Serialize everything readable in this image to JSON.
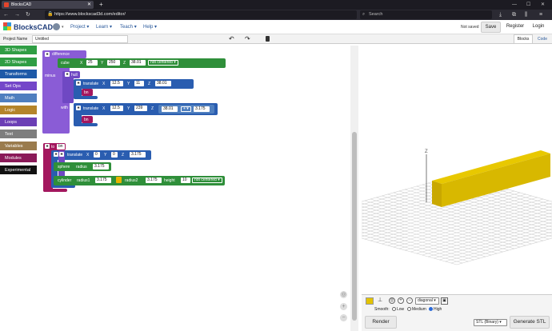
{
  "browser": {
    "tab_title": "BlocksCAD",
    "new_tab_symbol": "+",
    "url": "https://www.blockscad3d.com/editor/",
    "search_placeholder": "Search"
  },
  "header": {
    "logo_text": "BlocksCAD",
    "menu": {
      "project": "Project",
      "learn": "Learn",
      "teach": "Teach",
      "help": "Help"
    },
    "menu_arrow": "▾",
    "saved_status": "Not saved",
    "save_label": "Save",
    "register_label": "Register",
    "login_label": "Login"
  },
  "project": {
    "name_label": "Project Name",
    "name_value": "Untitled",
    "view_tabs": {
      "blocks": "Blocks",
      "code": "Code"
    }
  },
  "toolbox": {
    "items": [
      {
        "label": "3D Shapes",
        "color": "#2f9e44"
      },
      {
        "label": "2D Shapes",
        "color": "#2f9e44"
      },
      {
        "label": "Transforms",
        "color": "#1e5aa8"
      },
      {
        "label": "Set Ops",
        "color": "#7446c9"
      },
      {
        "label": "Math",
        "color": "#4f7fbf"
      },
      {
        "label": "Logic",
        "color": "#b4842a"
      },
      {
        "label": "Loops",
        "color": "#6b3fb5"
      },
      {
        "label": "Text",
        "color": "#7e7e7e"
      },
      {
        "label": "Variables",
        "color": "#9a7b4d"
      },
      {
        "label": "Modules",
        "color": "#8a1a58"
      },
      {
        "label": "Experimental",
        "color": "#111111"
      }
    ]
  },
  "blocks": {
    "difference": "difference",
    "minus": "minus",
    "with": "with",
    "hull": "hull",
    "bn": "bn",
    "cube": {
      "label": "cube",
      "x_label": "X",
      "x": "25",
      "y_label": "Y",
      "y": "250",
      "z_label": "Z",
      "z": "38.01",
      "mode": "not centered"
    },
    "translate1": {
      "label": "translate",
      "x_label": "X",
      "x": "12.5",
      "y_label": "Y",
      "y": "11",
      "z_label": "Z",
      "z": "38.01"
    },
    "translate2": {
      "label": "translate",
      "x_label": "X",
      "x": "12.5",
      "y_label": "Y",
      "y": "239",
      "z_label": "Z",
      "z_a": "38.01",
      "op": "+",
      "z_b": "3.175"
    },
    "func": {
      "to": "to",
      "name": "bn"
    },
    "translate3": {
      "label": "translate",
      "x_label": "X",
      "x": "0",
      "y_label": "Y",
      "y": "0",
      "z_label": "Z",
      "z": "3.175"
    },
    "sphere": {
      "label": "sphere",
      "radius_label": "radius",
      "radius": "3.175"
    },
    "cylinder": {
      "label": "cylinder",
      "r1_label": "radius1",
      "r1": "3.175",
      "r2_label": "radius2",
      "r2": "3.175",
      "h_label": "height",
      "h": "10",
      "mode": "not centered"
    }
  },
  "viewer": {
    "axis_label": "Z",
    "bar_color": "#e3c300",
    "view_mode": "diagonal",
    "smooth_label": "Smooth:",
    "smooth_options": [
      "Low",
      "Medium",
      "High"
    ],
    "smooth_selected": "High",
    "render_label": "Render",
    "format_value": "STL (Binary)",
    "generate_label": "Generate STL"
  }
}
